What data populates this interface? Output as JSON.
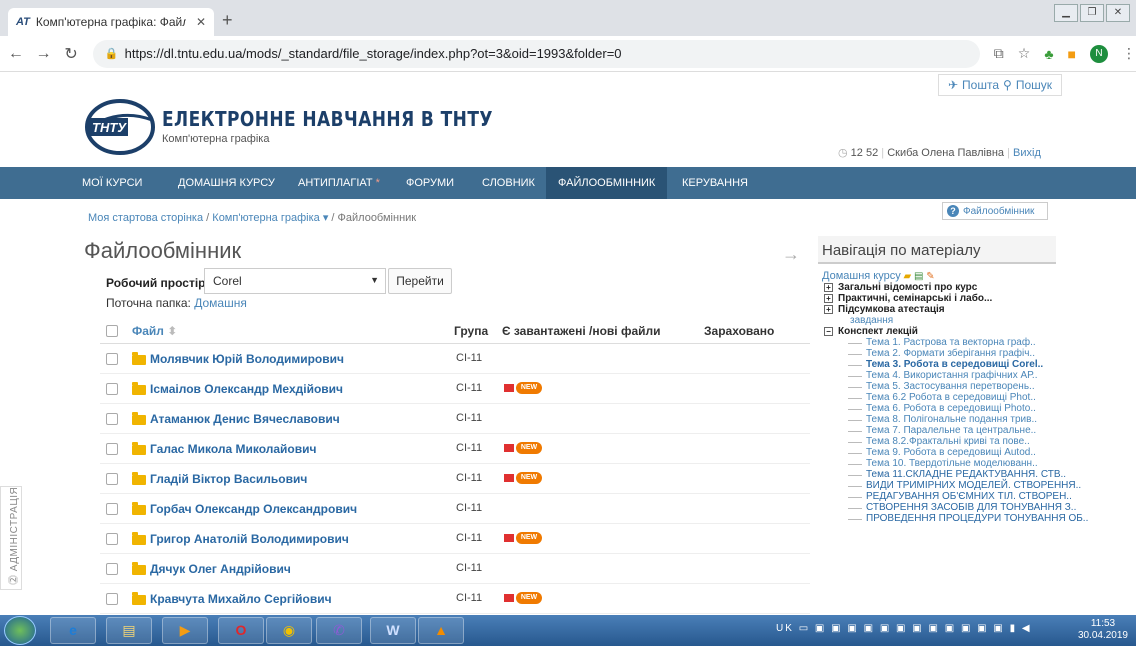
{
  "browser": {
    "tab_title": "Комп'ютерна графіка: Файлооб",
    "tab_favicon": "AT",
    "url": "https://dl.tntu.edu.ua/mods/_standard/file_storage/index.php?ot=3&oid=1993&folder=0",
    "avatar_letter": "N"
  },
  "header": {
    "mail": "Пошта",
    "search": "Пошук",
    "site_title": "ЕЛЕКТРОННЕ НАВЧАННЯ В ТНТУ",
    "course": "Комп'ютерна графіка",
    "logo_text": "ТНТУ",
    "time": "12 52",
    "user": "Скиба Олена Павлівна",
    "logout": "Вихід"
  },
  "menu": {
    "items": [
      "МОЇ КУРСИ",
      "ДОМАШНЯ КУРСУ",
      "АНТИПЛАГІАТ",
      "ФОРУМИ",
      "СЛОВНИК",
      "ФАЙЛООБМІННИК",
      "КЕРУВАННЯ"
    ],
    "star": "*"
  },
  "breadcrumb": {
    "home": "Моя стартова сторінка",
    "course": "Комп'ютерна графіка",
    "current": "Файлообмінник",
    "sep": "/"
  },
  "help_label": "Файлообмінник",
  "page_title": "Файлообмінник",
  "workspace": {
    "label": "Робочий простір",
    "selected": "Corel",
    "go": "Перейти",
    "folder_label": "Поточна папка:",
    "folder_value": "Домашня"
  },
  "table": {
    "headers": {
      "file": "Файл",
      "group": "Група",
      "uploaded": "Є завантажені /нові файли",
      "credited": "Зараховано"
    },
    "rows": [
      {
        "name": "Молявчик Юрій Володимирович",
        "group": "СІ-11",
        "new": false
      },
      {
        "name": "Ісмаілов Олександр Мехдійович",
        "group": "СІ-11",
        "new": true
      },
      {
        "name": "Атаманюк Денис Вячеславович",
        "group": "СІ-11",
        "new": false
      },
      {
        "name": "Галас Микола Миколайович",
        "group": "СІ-11",
        "new": true
      },
      {
        "name": "Гладій Віктор Васильович",
        "group": "СІ-11",
        "new": true
      },
      {
        "name": "Горбач Олександр Олександрович",
        "group": "СІ-11",
        "new": false
      },
      {
        "name": "Григор Анатолій Володимирович",
        "group": "СІ-11",
        "new": true
      },
      {
        "name": "Дячук Олег Андрійович",
        "group": "СІ-11",
        "new": false
      },
      {
        "name": "Кравчута Михайло Сергійович",
        "group": "СІ-11",
        "new": true
      }
    ],
    "new_badge": "NEW"
  },
  "sidenav": {
    "title": "Навігація по матеріалу",
    "home": "Домашня курсу",
    "sections": [
      "Загальні відомості про курс",
      "Практичні, семінарські і лабо...",
      "Підсумкова атестація"
    ],
    "zavdannia": "завдання",
    "konspekt": "Конспект лекцій",
    "topics": [
      "Тема 1. Растрова та векторна граф..",
      "Тема 2. Формати зберігання графіч..",
      "Тема 3. Робота в середовищі Corel..",
      "Тема 4. Використання графічних АР..",
      "Тема 5. Застосування перетворень..",
      "Тема 6.2 Робота в середовищі Phot..",
      "Тема 6. Робота в середовищі Photo..",
      "Тема 8. Полігональне подання трив..",
      "Тема 7. Паралельне та центральне..",
      "Тема 8.2.Фрактальні криві та пове..",
      "Тема 9. Робота в середовищі Autod..",
      "Тема 10. Твердотільне моделюванн..",
      "Тема 11.СКЛАДНЕ РЕДАКТУВАННЯ. СТВ..",
      "ВИДИ ТРИМІРНИХ МОДЕЛЕЙ. СТВОРЕННЯ..",
      "РЕДАГУВАННЯ ОБ'ЄМНИХ ТІЛ. СТВОРЕН..",
      "СТВОРЕННЯ ЗАСОБІВ ДЛЯ ТОНУВАННЯ З..",
      "ПРОВЕДЕННЯ ПРОЦЕДУРИ ТОНУВАННЯ ОБ.."
    ]
  },
  "admin_tab": "АДМІНІСТРАЦІЯ",
  "taskbar": {
    "lang": "UK",
    "time": "11:53",
    "date": "30.04.2019"
  }
}
